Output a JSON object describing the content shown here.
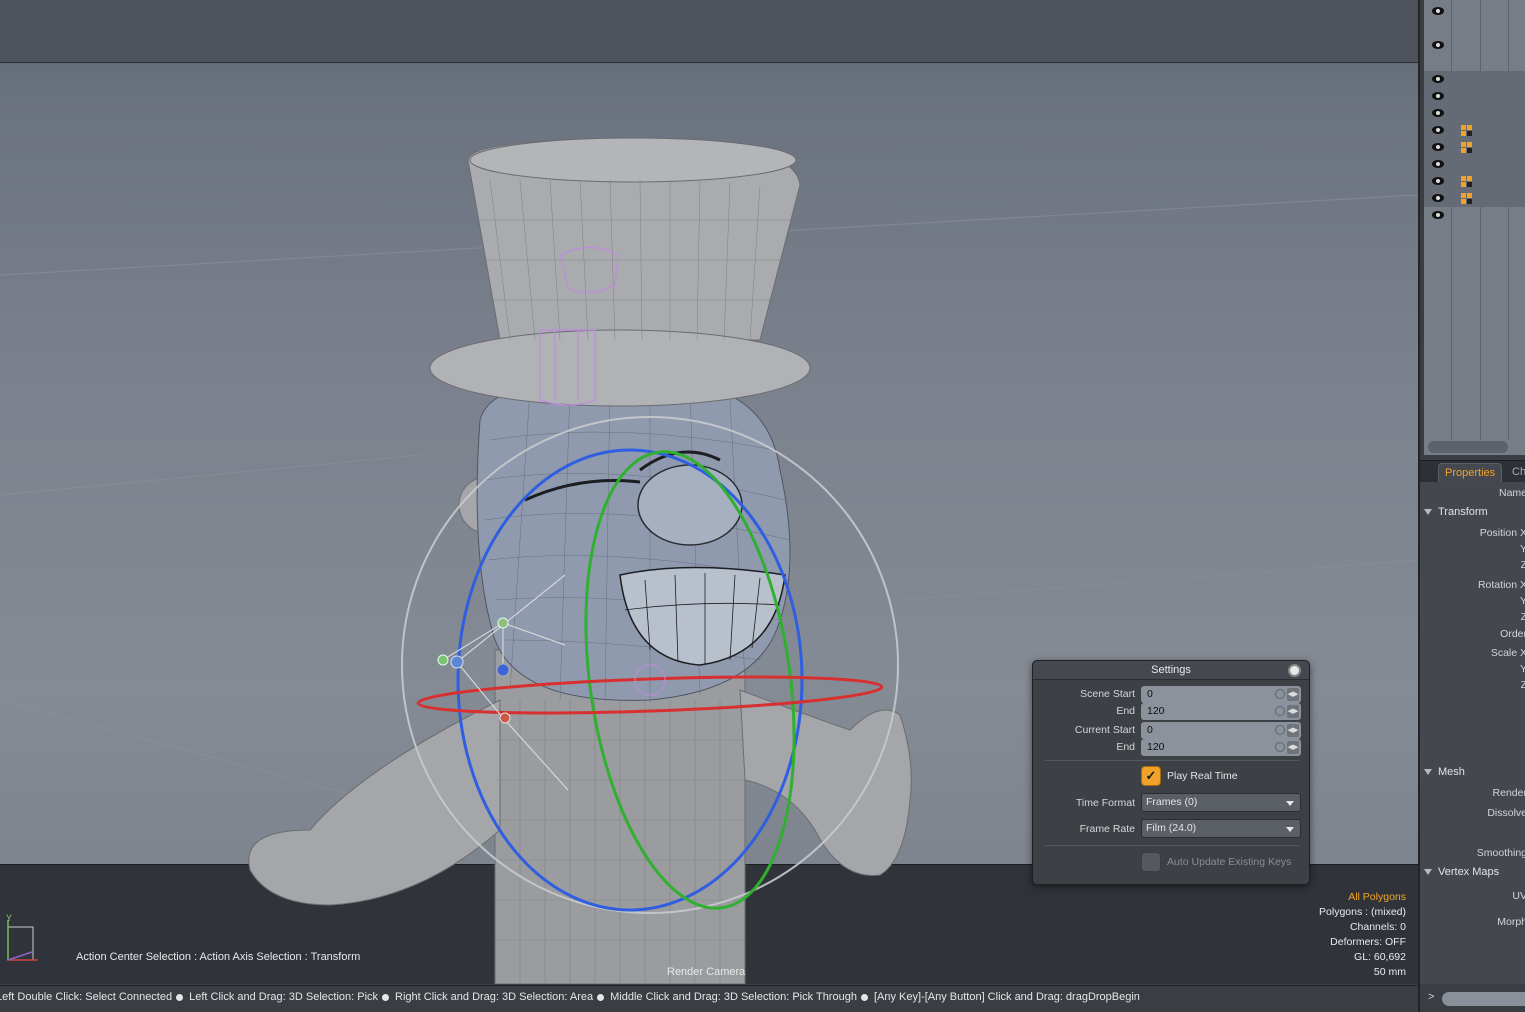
{
  "viewport": {
    "action_center_text": "Action Center Selection : Action Axis Selection : Transform",
    "camera_label": "Render Camera",
    "hud": {
      "all_polygons": "All Polygons",
      "polygons": "Polygons : (mixed)",
      "channels": "Channels: 0",
      "deformers": "Deformers: OFF",
      "gl": "GL: 60,692",
      "focal": "50 mm"
    },
    "axis_label": "Y"
  },
  "settings": {
    "title": "Settings",
    "scene_start_label": "Scene Start",
    "scene_start_value": "0",
    "scene_end_label": "End",
    "scene_end_value": "120",
    "current_start_label": "Current Start",
    "current_start_value": "0",
    "current_end_label": "End",
    "current_end_value": "120",
    "play_real_time_label": "Play Real Time",
    "play_real_time_checked": true,
    "time_format_label": "Time Format",
    "time_format_value": "Frames (0)",
    "frame_rate_label": "Frame Rate",
    "frame_rate_value": "Film (24.0)",
    "auto_update_label": "Auto Update Existing Keys",
    "auto_update_checked": false
  },
  "right_panel": {
    "tabs": [
      {
        "label": "Properties",
        "active": true
      },
      {
        "label": "Ch",
        "active": false
      }
    ],
    "properties": {
      "name_label": "Name",
      "transform_section": "Transform",
      "position_x": "Position X",
      "y1": "Y",
      "z1": "Z",
      "rotation_x": "Rotation X",
      "y2": "Y",
      "z2": "Z",
      "order": "Order",
      "scale_x": "Scale X",
      "y3": "Y",
      "z3": "Z",
      "mesh_section": "Mesh",
      "render": "Render",
      "dissolve": "Dissolve",
      "smoothing": "Smoothing",
      "vertex_maps_section": "Vertex Maps",
      "uv": "UV",
      "morph": "Morph"
    },
    "bottom_prompt": ">"
  },
  "status_bar": {
    "items": [
      "Left Double Click: Select Connected",
      "Left Click and Drag: 3D Selection: Pick",
      "Right Click and Drag: 3D Selection: Area",
      "Middle Click and Drag: 3D Selection: Pick Through",
      "[Any Key]-[Any Button] Click and Drag: dragDropBegin"
    ]
  },
  "colors": {
    "accent": "#f0a22a",
    "gizmo_x": "#d83030",
    "gizmo_y": "#30b030",
    "gizmo_z": "#3060e0"
  }
}
